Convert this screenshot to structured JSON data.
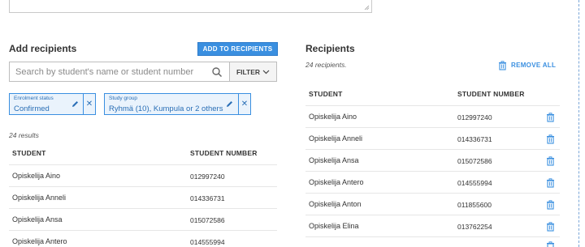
{
  "left": {
    "title": "Add recipients",
    "add_button": "ADD TO RECIPIENTS",
    "search_placeholder": "Search by student's name or student number",
    "filter_label": "FILTER",
    "chips": [
      {
        "label": "Enrolment status",
        "value": "Confirmed"
      },
      {
        "label": "Study group",
        "value": "Ryhmä (10), Kumpula or 2 others"
      }
    ],
    "results_count": "24 results",
    "columns": [
      "STUDENT",
      "STUDENT NUMBER"
    ],
    "rows": [
      {
        "name": "Opiskelija Aino",
        "number": "012997240"
      },
      {
        "name": "Opiskelija Anneli",
        "number": "014336731"
      },
      {
        "name": "Opiskelija Ansa",
        "number": "015072586"
      },
      {
        "name": "Opiskelija Antero",
        "number": "014555994"
      }
    ]
  },
  "right": {
    "title": "Recipients",
    "count": "24 recipients.",
    "remove_all": "REMOVE ALL",
    "columns": [
      "STUDENT",
      "STUDENT NUMBER"
    ],
    "rows": [
      {
        "name": "Opiskelija Aino",
        "number": "012997240"
      },
      {
        "name": "Opiskelija Anneli",
        "number": "014336731"
      },
      {
        "name": "Opiskelija Ansa",
        "number": "015072586"
      },
      {
        "name": "Opiskelija Antero",
        "number": "014555994"
      },
      {
        "name": "Opiskelija Anton",
        "number": "011855600"
      },
      {
        "name": "Opiskelija Elina",
        "number": "013762254"
      }
    ]
  },
  "icons": {
    "search": "search-icon",
    "chevron": "chevron-down-icon",
    "edit": "pencil-icon",
    "close": "close-icon",
    "delete": "trash-icon"
  },
  "colors": {
    "accent": "#3a8fe0",
    "chip_bg": "#eaf3fc",
    "text": "#333333"
  }
}
